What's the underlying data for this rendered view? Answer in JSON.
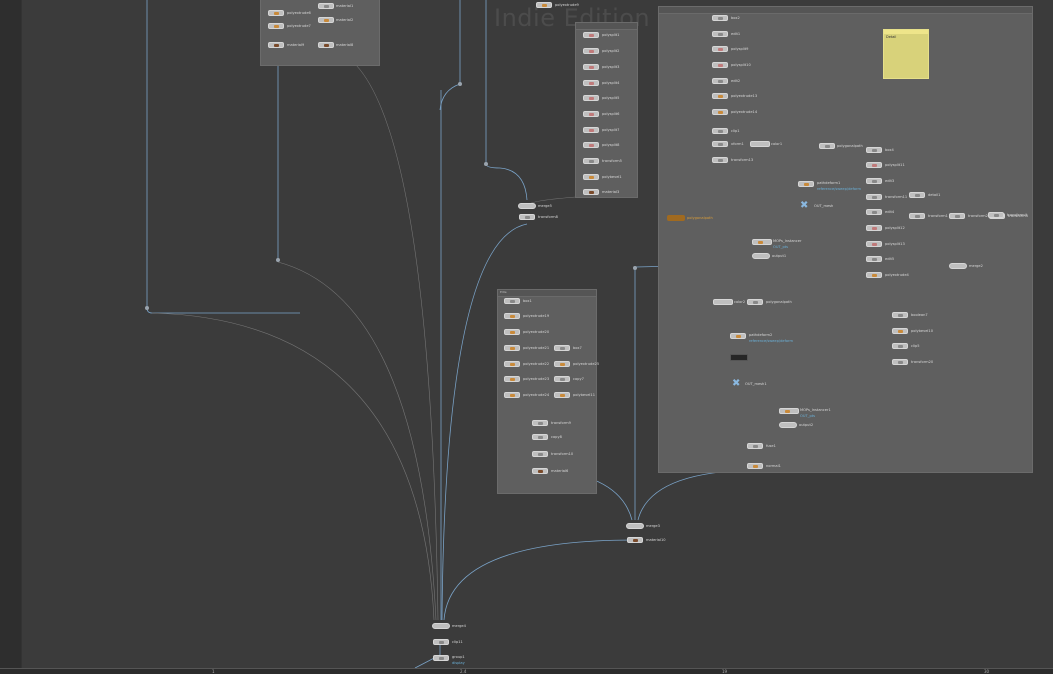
{
  "watermark": "Indie Edition",
  "colors": {
    "background": "#3b3b3b",
    "network_box": "#5f5f5f",
    "node": "#bfbfbf",
    "wire_blue": "#7aa3c8",
    "wire_grey": "#7a7a7a",
    "note": "#d8d27a",
    "flag_text": "#6ab0d8"
  },
  "ruler": {
    "ticks": [
      "1",
      "2.4",
      "19",
      "30"
    ]
  },
  "sticky_note": {
    "label": "Detail"
  },
  "boxes": {
    "top_left": {
      "label": ""
    },
    "top_mid": {
      "label": ""
    },
    "center": {
      "label": "Elite"
    },
    "right": {
      "label": ""
    }
  },
  "top_left_nodes": [
    {
      "label": "polyextrude6"
    },
    {
      "label": "polyextrude7"
    },
    {
      "label": "material9"
    },
    {
      "label": "material1"
    },
    {
      "label": "material2"
    },
    {
      "label": "material8"
    }
  ],
  "top_mid_nodes": [
    {
      "label": "polyextrude9"
    },
    {
      "label": "polysplit1"
    },
    {
      "label": "polysplit2"
    },
    {
      "label": "polysplit3"
    },
    {
      "label": "polysplit4"
    },
    {
      "label": "polysplit5"
    },
    {
      "label": "polysplit6"
    },
    {
      "label": "polysplit7"
    },
    {
      "label": "polysplit8"
    },
    {
      "label": "transform5"
    },
    {
      "label": "polybevel1"
    },
    {
      "label": "material3"
    }
  ],
  "mid_nodes": [
    {
      "label": "merge5"
    },
    {
      "label": "transform8"
    }
  ],
  "center_nodes_left": [
    {
      "label": "box1"
    },
    {
      "label": "polyextrude19"
    },
    {
      "label": "polyextrude20"
    },
    {
      "label": "polyextrude21"
    },
    {
      "label": "polyextrude22"
    },
    {
      "label": "polyextrude23"
    },
    {
      "label": "polyextrude24"
    }
  ],
  "center_nodes_right": [
    {
      "label": "box7"
    },
    {
      "label": "polyextrude25"
    },
    {
      "label": "copy7"
    },
    {
      "label": "polybevel11"
    }
  ],
  "center_bottom_nodes": [
    {
      "label": "transform9"
    },
    {
      "label": "copy8"
    },
    {
      "label": "transform10"
    },
    {
      "label": "material6"
    }
  ],
  "right_col1": [
    {
      "label": "box2"
    },
    {
      "label": "edit1"
    },
    {
      "label": "polysplit9"
    },
    {
      "label": "polysplit10"
    },
    {
      "label": "edit2"
    },
    {
      "label": "polyextrude13"
    },
    {
      "label": "polyextrude14"
    },
    {
      "label": "clip1"
    },
    {
      "label": "xform1"
    },
    {
      "label": "transform13"
    }
  ],
  "right_misc": {
    "color1": "color1",
    "pathdeform1": "pathdeform1",
    "ref_note": "reference/sweep/deform",
    "out_node": "OUT_mesh",
    "edit_input": "polygonalpath",
    "mops": "MOPs_Instancer",
    "mops_flag1": "(instanced)",
    "mops_flag2": "OUT_pts",
    "output1": "output1",
    "color2": "color2",
    "pathdeform2": "pathdeform2",
    "ref_note2": "reference/sweep/deform",
    "out_node2": "OUT_mesh1",
    "mops2": "MOPs_Instancer1",
    "mops2_flag": "OUT_pts",
    "output2": "output2",
    "fuse1": "fuse1",
    "normal1": "normal1"
  },
  "right_col2": [
    {
      "label": "box4"
    },
    {
      "label": "polysplit11"
    },
    {
      "label": "edit3"
    },
    {
      "label": "transform11"
    },
    {
      "label": "edit4"
    },
    {
      "label": "polysplit12"
    },
    {
      "label": "polysplit13"
    },
    {
      "label": "edit5"
    },
    {
      "label": "polyextrude4"
    }
  ],
  "right_col2_side": {
    "label": "detail1"
  },
  "right_row": [
    "transform1",
    "transform2",
    "transform3",
    "transform4"
  ],
  "right_merge": {
    "label": "merge2"
  },
  "right_tail": [
    {
      "label": "boolean7"
    },
    {
      "label": "polybevel10"
    },
    {
      "label": "clip5"
    },
    {
      "label": "transform20"
    }
  ],
  "center_merge": {
    "label": "merge3"
  },
  "center_merge_out": {
    "label": "material10"
  },
  "bottom_nodes": [
    {
      "label": "merge4"
    },
    {
      "label": "clip11"
    },
    {
      "label": "group1"
    }
  ],
  "bottom_flag": "display"
}
